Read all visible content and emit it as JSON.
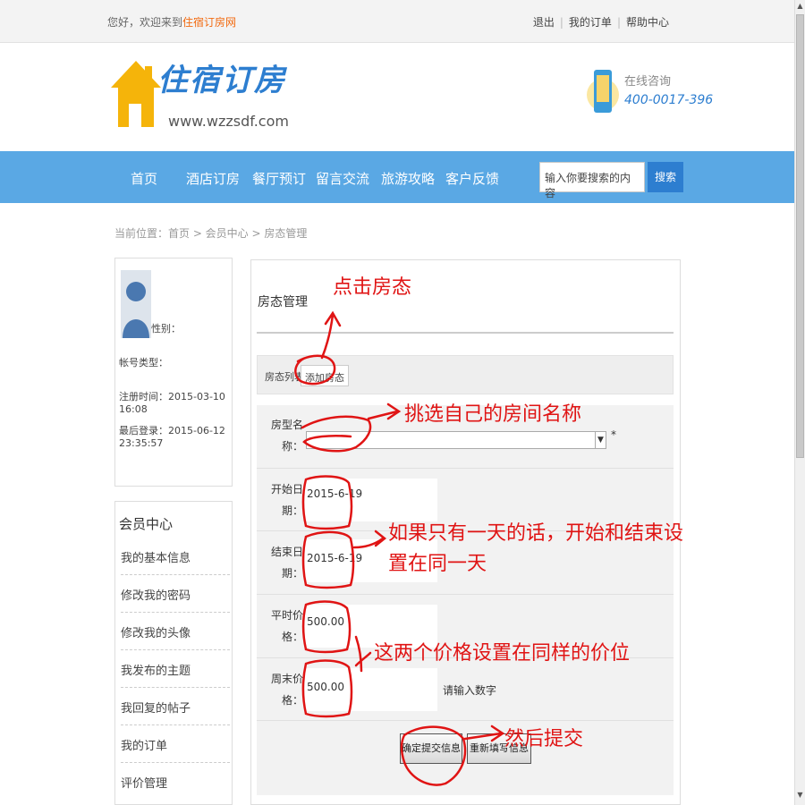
{
  "topbar": {
    "welcome_prefix": "您好，欢迎来到",
    "site_name": "住宿订房网",
    "links": [
      "退出",
      "我的订单",
      "帮助中心"
    ]
  },
  "header": {
    "logo_text": "住宿订房",
    "logo_url": "www.wzzsdf.com",
    "hotline_label": "在线咨询",
    "hotline_number": "400-0017-396"
  },
  "nav": {
    "items": [
      "首页",
      "酒店订房",
      "餐厅预订",
      "留言交流",
      "旅游攻略",
      "客户反馈"
    ],
    "search_placeholder": "输入你要搜索的内容",
    "search_button": "搜索"
  },
  "breadcrumb": "当前位置：首页 > 会员中心 > 房态管理",
  "profile": {
    "gender_label": "性别：",
    "account_type": "帐号类型：",
    "register_time": "注册时间：2015-03-10 16:08",
    "last_login": "最后登录：2015-06-12 23:35:57"
  },
  "member_menu": {
    "title": "会员中心",
    "items": [
      "我的基本信息",
      "修改我的密码",
      "修改我的头像",
      "我发布的主题",
      "我回复的帖子",
      "我的订单",
      "评价管理"
    ]
  },
  "panel": {
    "title": "房态管理",
    "tabs": [
      "房态列表",
      "添加房态"
    ],
    "form": {
      "room_type_label": "房型名称：",
      "required_mark": "*",
      "start_date_label": "开始日期：",
      "start_date_value": "2015-6-19",
      "end_date_label": "结束日期：",
      "end_date_value": "2015-6-19",
      "weekday_price_label": "平时价格：",
      "weekday_price_value": "500.00",
      "weekend_price_label": "周末价格：",
      "weekend_price_value": "500.00",
      "number_hint": "请输入数字",
      "submit_button": "确定提交信息",
      "reset_button": "重新填写信息"
    }
  },
  "annotations": {
    "click_room_state": "点击房态",
    "pick_room_name": "挑选自己的房间名称",
    "one_day_line1": "如果只有一天的话，开始和结束设",
    "one_day_line2": "置在同一天",
    "same_price": "这两个价格设置在同样的价位",
    "then_submit": "然后提交"
  },
  "colors": {
    "nav_blue": "#5aa8e4",
    "accent_orange": "#f26a10",
    "annotation_red": "#e01414"
  }
}
